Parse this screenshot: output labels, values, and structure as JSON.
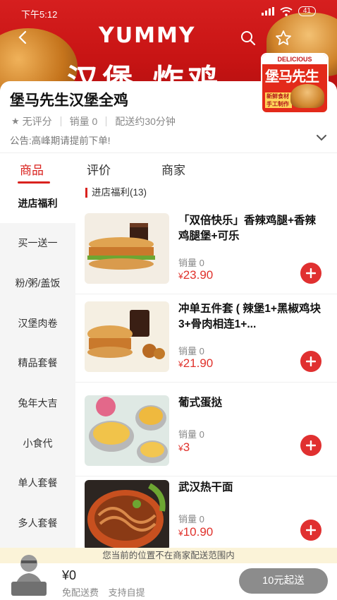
{
  "status_bar": {
    "time": "下午5:12",
    "battery": "41"
  },
  "banner": {
    "slogan_en": "YUMMY",
    "slogan_cn": "汉堡 炸鸡"
  },
  "shop": {
    "name": "堡马先生汉堡全鸡",
    "rating": "无评分",
    "sales": "销量 0",
    "delivery": "配送约30分钟",
    "notice": "公告:高峰期请提前下单!",
    "logo": {
      "top": "DELICIOUS",
      "name": "堡马先生",
      "tag": "新鲜食材 手工制作"
    }
  },
  "tabs": [
    {
      "label": "商品"
    },
    {
      "label": "评价"
    },
    {
      "label": "商家"
    }
  ],
  "sidebar": {
    "items": [
      {
        "label": "进店福利"
      },
      {
        "label": "买一送一"
      },
      {
        "label": "粉/粥/盖饭"
      },
      {
        "label": "汉堡肉卷"
      },
      {
        "label": "精品套餐"
      },
      {
        "label": "兔年大吉"
      },
      {
        "label": "小食代"
      },
      {
        "label": "单人套餐"
      },
      {
        "label": "多人套餐"
      }
    ]
  },
  "section": {
    "title": "进店福利(13)"
  },
  "items": [
    {
      "name": "「双倍快乐」香辣鸡腿+香辣鸡腿堡+可乐",
      "sales": "销量 0",
      "currency": "¥",
      "price": "23.90"
    },
    {
      "name": "冲单五件套 ( 辣堡1+黑椒鸡块3+骨肉相连1+...",
      "sales": "销量 0",
      "currency": "¥",
      "price": "21.90"
    },
    {
      "name": "葡式蛋挞",
      "sales": "销量 0",
      "currency": "¥",
      "price": "3"
    },
    {
      "name": "武汉热干面",
      "sales": "销量 0",
      "currency": "¥",
      "price": "10.90"
    }
  ],
  "delivery_notice": "您当前的位置不在商家配送范围内",
  "cart": {
    "total": "¥0",
    "free_delivery": "免配送费",
    "self_pickup": "支持自提",
    "checkout_label": "10元起送"
  },
  "colors": {
    "accent": "#d9221e",
    "price": "#e0322c",
    "checkout_disabled": "#8c8c8c"
  }
}
